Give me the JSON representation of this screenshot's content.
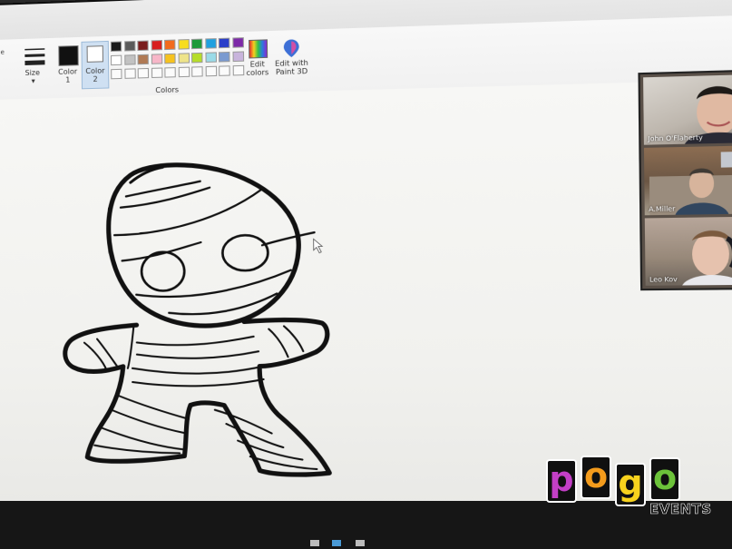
{
  "window": {
    "minimize_glyph": "—",
    "maximize_glyph": "▢"
  },
  "ribbon": {
    "outline_label": "tline",
    "size_label": "Size",
    "color1_label": "Color 1",
    "color2_label": "Color 2",
    "colors_group_label": "Colors",
    "edit_colors_label": "Edit colors",
    "edit_paint3d_label": "Edit with Paint 3D",
    "color1_value": "#111111",
    "color2_value": "#ffffff",
    "palette_row1": [
      "#1a1a1a",
      "#5a5a5a",
      "#7a1c1c",
      "#d81e1e",
      "#f26b1d",
      "#f7dd1f",
      "#1d9a3a",
      "#1fa0e0",
      "#2a3ec9",
      "#7d2aa8"
    ],
    "palette_row2": [
      "#ffffff",
      "#c2c2c2",
      "#b07a55",
      "#f7b6c8",
      "#f6c21f",
      "#eee48a",
      "#b6dd2a",
      "#9adbe8",
      "#7a9ad0",
      "#c8b4dc"
    ]
  },
  "participants": [
    {
      "name": "John O'Flaherty"
    },
    {
      "name": "A.Miller"
    },
    {
      "name": "Leo Kov"
    }
  ],
  "logo": {
    "letters": [
      "p",
      "o",
      "g",
      "o"
    ],
    "letter_colors": [
      "#c33fc6",
      "#f39b1c",
      "#f7d21d",
      "#6cc23a"
    ],
    "tagline": "EVENTS"
  },
  "icons": [
    "palette-icon",
    "paint3d-icon",
    "cursor-icon"
  ]
}
